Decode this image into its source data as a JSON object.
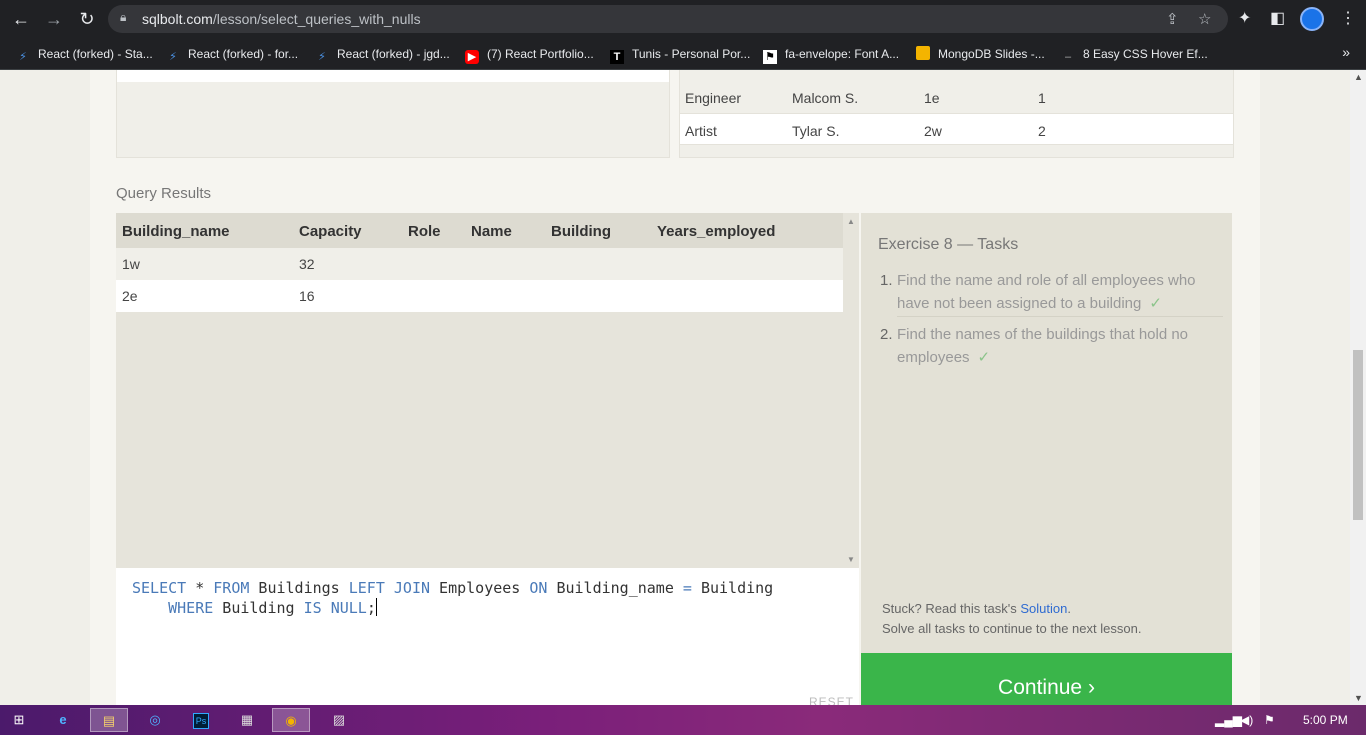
{
  "browser": {
    "url_domain": "sqlbolt.com",
    "url_path": "/lesson/select_queries_with_nulls",
    "bookmarks": [
      {
        "label": "React (forked) - Sta...",
        "icon": "bolt-icon"
      },
      {
        "label": "React (forked) - for...",
        "icon": "bolt-icon"
      },
      {
        "label": "React (forked) - jgd...",
        "icon": "bolt-icon"
      },
      {
        "label": "(7) React Portfolio...",
        "icon": "youtube-icon"
      },
      {
        "label": "Tunis - Personal Por...",
        "icon": "t-icon"
      },
      {
        "label": "fa-envelope: Font A...",
        "icon": "flag-icon"
      },
      {
        "label": "MongoDB Slides -...",
        "icon": "slides-icon"
      },
      {
        "label": "8 Easy CSS Hover Ef...",
        "icon": "dash-icon"
      }
    ],
    "more_label": "»"
  },
  "top_right_table": {
    "rows": [
      [
        "Engineer",
        "Malcom S.",
        "1e",
        "1"
      ],
      [
        "Artist",
        "Tylar S.",
        "2w",
        "2"
      ]
    ]
  },
  "results": {
    "label": "Query Results",
    "headers": [
      "Building_name",
      "Capacity",
      "Role",
      "Name",
      "Building",
      "Years_employed"
    ],
    "rows": [
      [
        "1w",
        "32"
      ],
      [
        "2e",
        "16"
      ]
    ]
  },
  "editor": {
    "reset_label": "RESET"
  },
  "tasks": {
    "title": "Exercise 8 — Tasks",
    "items": [
      {
        "num": "1.",
        "text": "Find the name and role of all employees who have not been assigned to a building"
      },
      {
        "num": "2.",
        "text": "Find the names of the buildings that hold no employees"
      }
    ],
    "check": "✓",
    "stuck_text": "Stuck? Read this task's ",
    "solution_link": "Solution",
    "stuck_end": ".",
    "solve_all": "Solve all tasks to continue to the next lesson."
  },
  "continue_label": "Continue ›",
  "taskbar": {
    "time": "5:00 PM"
  },
  "colors": {
    "continue": "#3ab54a",
    "keyword": "#4a7ab8",
    "link": "#2f6bd1",
    "check": "#8bc48a"
  }
}
